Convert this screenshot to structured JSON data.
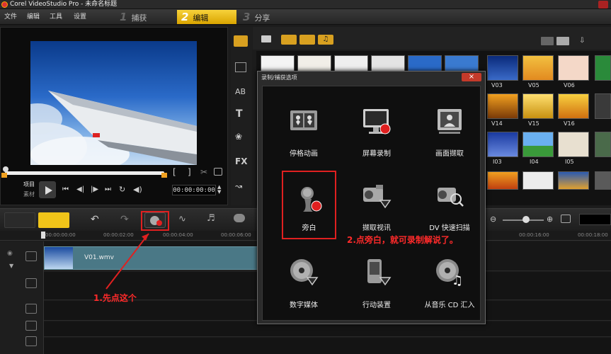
{
  "window": {
    "title": "Corel VideoStudio Pro - 未命名标题"
  },
  "menu": {
    "file": "文件",
    "edit": "编辑",
    "tools": "工具",
    "settings": "设置"
  },
  "steps": [
    {
      "num": "1",
      "label": "捕获"
    },
    {
      "num": "2",
      "label": "编辑"
    },
    {
      "num": "3",
      "label": "分享"
    }
  ],
  "player": {
    "project_label": "项目",
    "clip_label": "素材",
    "timecode": "00:00:00:00",
    "bracket_in": "[",
    "bracket_out": "]"
  },
  "library": {
    "thumbs": [
      "V03",
      "V05",
      "V06",
      "V14",
      "V15",
      "V16",
      "I03",
      "I04",
      "I05"
    ]
  },
  "timeline": {
    "ticks": [
      "00:00:00:00",
      "00:00:02:00",
      "00:00:04:00",
      "00:00:06:00",
      "00:00:16:00",
      "00:00:18:00"
    ],
    "clip_name": "V01.wmv"
  },
  "dialog": {
    "title": "录制/捕获选项",
    "close": "×",
    "items": [
      {
        "label": "停格动画"
      },
      {
        "label": "屏幕录制"
      },
      {
        "label": "画面撷取"
      },
      {
        "label": "旁白"
      },
      {
        "label": "撷取视讯"
      },
      {
        "label": "DV 快速扫描"
      },
      {
        "label": "数字媒体"
      },
      {
        "label": "行动装置"
      },
      {
        "label": "从音乐 CD 汇入"
      }
    ]
  },
  "annotations": {
    "step1": "1.先点这个",
    "step2": "2.点旁白，就可录制解说了。"
  },
  "colors": {
    "accent": "#f0c419",
    "annotation": "#ff2a2a"
  }
}
